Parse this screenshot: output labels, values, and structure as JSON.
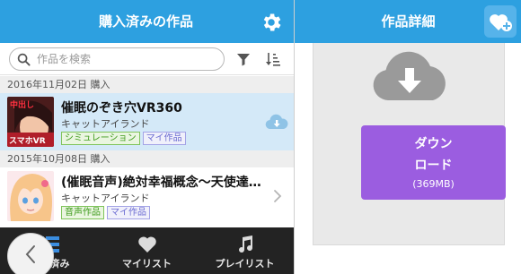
{
  "left_header": {
    "title": "購入済みの作品"
  },
  "search": {
    "placeholder": "作品を検索"
  },
  "sections": [
    {
      "date": "2016年11月02日 購入",
      "item": {
        "title": "催眠のぞき穴VR360",
        "author": "キャットアイランド",
        "tags": [
          "シミュレーション",
          "マイ作品"
        ],
        "thumb_text_top": "中出し",
        "thumb_text_bottom": "スマホVR"
      }
    },
    {
      "date": "2015年10月08日 購入",
      "item": {
        "title": "(催眠音声)絶対幸福概念～天使達…",
        "author": "キャットアイランド",
        "tags": [
          "音声作品",
          "マイ作品"
        ]
      }
    }
  ],
  "tabbar": {
    "tabs": [
      {
        "label": "済み",
        "icon": "list-icon"
      },
      {
        "label": "マイリスト",
        "icon": "heart-icon"
      },
      {
        "label": "プレイリスト",
        "icon": "music-note-icon"
      }
    ]
  },
  "right_header": {
    "title": "作品詳細"
  },
  "download": {
    "line1": "ダウン",
    "line2": "ロード",
    "size": "(369MB)"
  },
  "colors": {
    "header_blue": "#2da0e0",
    "selected_row": "#d4e9f8",
    "download_purple": "#9b5de0",
    "tab_bar": "#232323",
    "tag_green": "#3d9a1b",
    "tag_purple": "#6b6bd1"
  }
}
